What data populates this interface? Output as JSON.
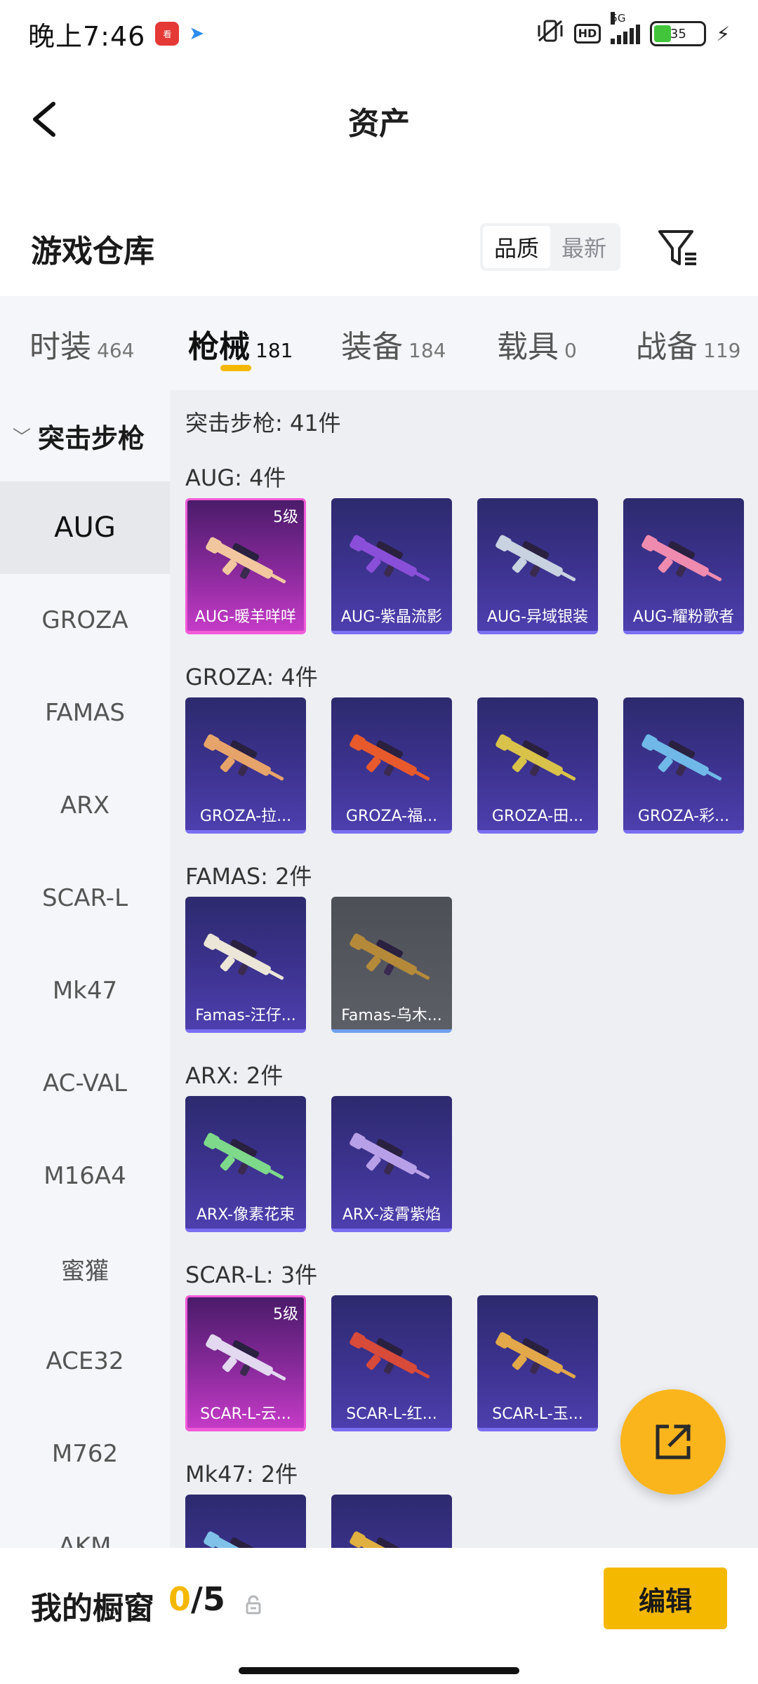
{
  "status_bar": {
    "time": "晚上7:46",
    "hd": "HD",
    "network": "5G",
    "battery": "35",
    "battery_level": 0.35
  },
  "nav": {
    "title": "资产"
  },
  "warehouse": {
    "title": "游戏仓库",
    "sort_options": [
      "品质",
      "最新"
    ],
    "active_sort": "品质"
  },
  "tabs": [
    {
      "label": "时装",
      "count": "464"
    },
    {
      "label": "枪械",
      "count": "181"
    },
    {
      "label": "装备",
      "count": "184"
    },
    {
      "label": "载具",
      "count": "0"
    },
    {
      "label": "战备",
      "count": "119"
    }
  ],
  "active_tab": "枪械",
  "sidebar": {
    "category": "突击步枪",
    "items": [
      "AUG",
      "GROZA",
      "FAMAS",
      "ARX",
      "SCAR-L",
      "Mk47",
      "AC-VAL",
      "M16A4",
      "蜜獾",
      "ACE32",
      "M762",
      "AKM"
    ],
    "active_item": "AUG"
  },
  "content": {
    "category_total": "突击步枪: 41件",
    "groups": [
      {
        "title": "AUG: 4件",
        "items": [
          {
            "label": "AUG-暖羊咩咩",
            "level": "5级",
            "rarity": "gold",
            "color": "#f2c7a0"
          },
          {
            "label": "AUG-紫晶流影",
            "level": "",
            "rarity": "purple",
            "color": "#8a4fd8"
          },
          {
            "label": "AUG-异域银装",
            "level": "",
            "rarity": "purple",
            "color": "#c8d2e0"
          },
          {
            "label": "AUG-耀粉歌者",
            "level": "",
            "rarity": "purple",
            "color": "#f08bb0"
          }
        ]
      },
      {
        "title": "GROZA: 4件",
        "items": [
          {
            "label": "GROZA-拉...",
            "level": "",
            "rarity": "purple",
            "color": "#e7a46a"
          },
          {
            "label": "GROZA-福...",
            "level": "",
            "rarity": "purple",
            "color": "#e85a2c"
          },
          {
            "label": "GROZA-田...",
            "level": "",
            "rarity": "purple",
            "color": "#d8c24a"
          },
          {
            "label": "GROZA-彩...",
            "level": "",
            "rarity": "purple",
            "color": "#6fb8e8"
          }
        ]
      },
      {
        "title": "FAMAS: 2件",
        "items": [
          {
            "label": "Famas-汪仔...",
            "level": "",
            "rarity": "purple",
            "color": "#ece6d8"
          },
          {
            "label": "Famas-乌木...",
            "level": "",
            "rarity": "grey",
            "color": "#b48a3a"
          }
        ]
      },
      {
        "title": "ARX: 2件",
        "items": [
          {
            "label": "ARX-像素花束",
            "level": "",
            "rarity": "purple",
            "color": "#7ed98a"
          },
          {
            "label": "ARX-凌霄紫焰",
            "level": "",
            "rarity": "purple",
            "color": "#b8a0e8"
          }
        ]
      },
      {
        "title": "SCAR-L: 3件",
        "items": [
          {
            "label": "SCAR-L-云...",
            "level": "5级",
            "rarity": "gold",
            "color": "#e2d8f0"
          },
          {
            "label": "SCAR-L-红...",
            "level": "",
            "rarity": "purple",
            "color": "#d84a3a"
          },
          {
            "label": "SCAR-L-玉...",
            "level": "",
            "rarity": "purple",
            "color": "#e2a84a"
          }
        ]
      },
      {
        "title": "Mk47: 2件",
        "items": [
          {
            "label": "",
            "level": "",
            "rarity": "purple",
            "color": "#7fc1e8"
          },
          {
            "label": "",
            "level": "",
            "rarity": "purple",
            "color": "#e0b040"
          }
        ]
      }
    ]
  },
  "bottom_bar": {
    "showcase_label": "我的橱窗",
    "showcase_current": "0",
    "showcase_sep": "/",
    "showcase_max": "5",
    "edit_label": "编辑"
  },
  "colors": {
    "accent": "#f5b800",
    "fab": "#fbb51c",
    "card_purple": "#3d3390",
    "card_gold": "#c43bc6"
  },
  "icons": {
    "back": "chevron-left-icon",
    "filter": "filter-icon",
    "share": "external-link-icon",
    "lock": "lock-icon"
  }
}
